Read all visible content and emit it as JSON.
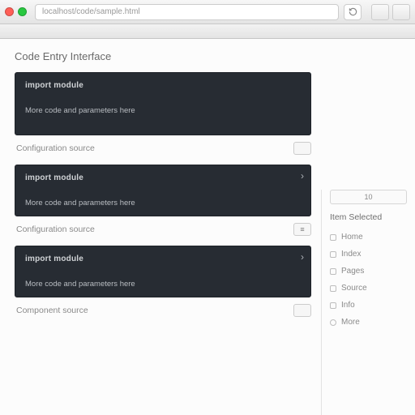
{
  "window": {
    "address": "localhost/code/sample.html"
  },
  "page": {
    "title": "Code Entry Interface"
  },
  "blocks": [
    {
      "line1": "import module",
      "line2": "More code and parameters here",
      "caption": "Configuration source"
    },
    {
      "line1": "import module",
      "line2": "More code and parameters here",
      "caption": "Configuration source"
    },
    {
      "line1": "import module",
      "line2": "More code and parameters here",
      "caption": "Component source"
    }
  ],
  "sidebar": {
    "pill": "10",
    "title": "Item Selected",
    "items": [
      {
        "label": "Home"
      },
      {
        "label": "Index"
      },
      {
        "label": "Pages"
      },
      {
        "label": "Source"
      },
      {
        "label": "Info"
      },
      {
        "label": "More"
      }
    ]
  }
}
